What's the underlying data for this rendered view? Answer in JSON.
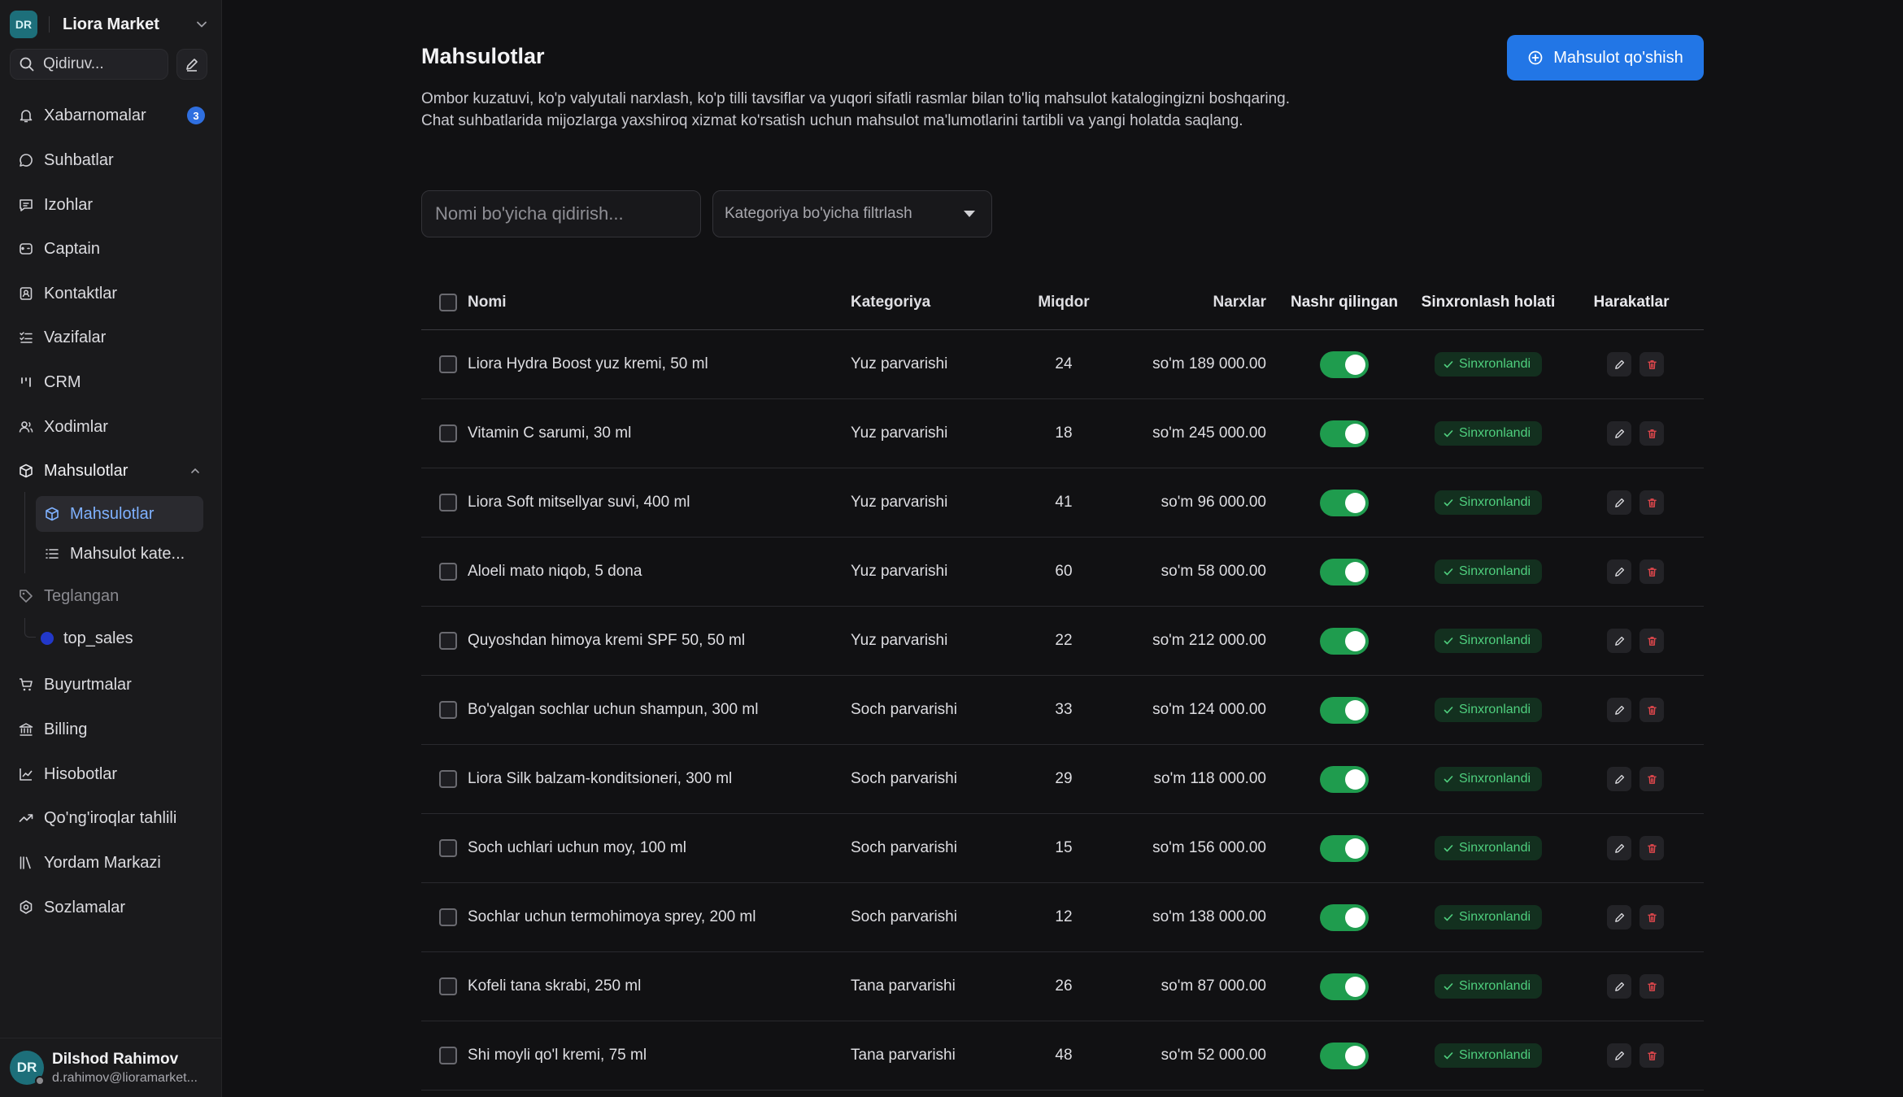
{
  "workspace": {
    "initials": "DR",
    "name": "Liora Market"
  },
  "search": {
    "placeholder": "Qidiruv..."
  },
  "sidebar": {
    "items": [
      {
        "label": "Xabarnomalar",
        "icon": "bell-icon",
        "badge": "3"
      },
      {
        "label": "Suhbatlar",
        "icon": "chat-icon"
      },
      {
        "label": "Izohlar",
        "icon": "comment-icon"
      },
      {
        "label": "Captain",
        "icon": "captain-icon"
      },
      {
        "label": "Kontaktlar",
        "icon": "contacts-icon"
      },
      {
        "label": "Vazifalar",
        "icon": "tasks-icon"
      },
      {
        "label": "CRM",
        "icon": "crm-icon"
      },
      {
        "label": "Xodimlar",
        "icon": "users-icon"
      },
      {
        "label": "Mahsulotlar",
        "icon": "box-icon"
      }
    ],
    "sub_items": [
      {
        "label": "Mahsulotlar",
        "icon": "box-icon"
      },
      {
        "label": "Mahsulot kate...",
        "icon": "list-icon"
      }
    ],
    "tags_label": "Teglangan",
    "tags": [
      {
        "label": "top_sales",
        "color": "#2238c9"
      }
    ],
    "bottom_items": [
      {
        "label": "Buyurtmalar",
        "icon": "cart-icon"
      },
      {
        "label": "Billing",
        "icon": "bank-icon"
      },
      {
        "label": "Hisobotlar",
        "icon": "chart-icon"
      },
      {
        "label": "Qo'ng'iroqlar tahlili",
        "icon": "trend-icon"
      },
      {
        "label": "Yordam Markazi",
        "icon": "library-icon"
      },
      {
        "label": "Sozlamalar",
        "icon": "settings-icon"
      }
    ]
  },
  "user": {
    "initials": "DR",
    "name": "Dilshod Rahimov",
    "email": "d.rahimov@lioramarket..."
  },
  "page": {
    "title": "Mahsulotlar",
    "description": "Ombor kuzatuvi, ko'p valyutali narxlash, ko'p tilli tavsiflar va yuqori sifatli rasmlar bilan to'liq mahsulot katalogingizni boshqaring. Chat suhbatlarida mijozlarga yaxshiroq xizmat ko'rsatish uchun mahsulot ma'lumotlarini tartibli va yangi holatda saqlang.",
    "add_button": "Mahsulot qo'shish"
  },
  "filters": {
    "name_placeholder": "Nomi bo'yicha qidirish...",
    "category_placeholder": "Kategoriya bo'yicha filtrlash"
  },
  "table": {
    "columns": [
      "Nomi",
      "Kategoriya",
      "Miqdor",
      "Narxlar",
      "Nashr qilingan",
      "Sinxronlash holati",
      "Harakatlar"
    ],
    "sync_label": "Sinxronlandi",
    "rows": [
      {
        "name": "Liora Hydra Boost yuz kremi, 50 ml",
        "category": "Yuz parvarishi",
        "qty": "24",
        "price": "so'm 189 000.00"
      },
      {
        "name": "Vitamin C sarumi, 30 ml",
        "category": "Yuz parvarishi",
        "qty": "18",
        "price": "so'm 245 000.00"
      },
      {
        "name": "Liora Soft mitsellyar suvi, 400 ml",
        "category": "Yuz parvarishi",
        "qty": "41",
        "price": "so'm 96 000.00"
      },
      {
        "name": "Aloeli mato niqob, 5 dona",
        "category": "Yuz parvarishi",
        "qty": "60",
        "price": "so'm 58 000.00"
      },
      {
        "name": "Quyoshdan himoya kremi SPF 50, 50 ml",
        "category": "Yuz parvarishi",
        "qty": "22",
        "price": "so'm 212 000.00"
      },
      {
        "name": "Bo'yalgan sochlar uchun shampun, 300 ml",
        "category": "Soch parvarishi",
        "qty": "33",
        "price": "so'm 124 000.00"
      },
      {
        "name": "Liora Silk balzam-konditsioneri, 300 ml",
        "category": "Soch parvarishi",
        "qty": "29",
        "price": "so'm 118 000.00"
      },
      {
        "name": "Soch uchlari uchun moy, 100 ml",
        "category": "Soch parvarishi",
        "qty": "15",
        "price": "so'm 156 000.00"
      },
      {
        "name": "Sochlar uchun termohimoya sprey, 200 ml",
        "category": "Soch parvarishi",
        "qty": "12",
        "price": "so'm 138 000.00"
      },
      {
        "name": "Kofeli tana skrabi, 250 ml",
        "category": "Tana parvarishi",
        "qty": "26",
        "price": "so'm 87 000.00"
      },
      {
        "name": "Shi moyli qo'l kremi, 75 ml",
        "category": "Tana parvarishi",
        "qty": "48",
        "price": "so'm 52 000.00"
      }
    ]
  },
  "colors": {
    "accent": "#2276e6",
    "published": "#1f9c4e",
    "synced": "#4fcf7e",
    "delete": "#e5484d"
  }
}
